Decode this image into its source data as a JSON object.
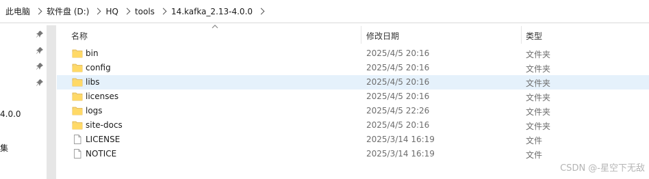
{
  "breadcrumb": {
    "items": [
      "此电脑",
      "软件盘 (D:)",
      "HQ",
      "tools",
      "14.kafka_2.13-4.0.0"
    ]
  },
  "nav_pane": {
    "partial_items": [
      "4.0.0",
      "集"
    ]
  },
  "columns": {
    "name": "名称",
    "date": "修改日期",
    "type": "类型",
    "sorted_by": "name"
  },
  "files": [
    {
      "name": "bin",
      "modified": "2025/4/5 20:16",
      "type": "文件夹",
      "kind": "folder",
      "selected": false
    },
    {
      "name": "config",
      "modified": "2025/4/5 20:16",
      "type": "文件夹",
      "kind": "folder",
      "selected": false
    },
    {
      "name": "libs",
      "modified": "2025/4/5 20:16",
      "type": "文件夹",
      "kind": "folder",
      "selected": true
    },
    {
      "name": "licenses",
      "modified": "2025/4/5 20:16",
      "type": "文件夹",
      "kind": "folder",
      "selected": false
    },
    {
      "name": "logs",
      "modified": "2025/4/5 22:26",
      "type": "文件夹",
      "kind": "folder",
      "selected": false
    },
    {
      "name": "site-docs",
      "modified": "2025/4/5 20:16",
      "type": "文件夹",
      "kind": "folder",
      "selected": false
    },
    {
      "name": "LICENSE",
      "modified": "2025/3/14 16:19",
      "type": "文件",
      "kind": "file",
      "selected": false
    },
    {
      "name": "NOTICE",
      "modified": "2025/3/14 16:19",
      "type": "文件",
      "kind": "file",
      "selected": false
    }
  ],
  "watermark": "CSDN @-星空下无敌",
  "colors": {
    "selection": "#e5f1fb",
    "folder": "#f8d775",
    "folder_dark": "#e0b03c"
  }
}
